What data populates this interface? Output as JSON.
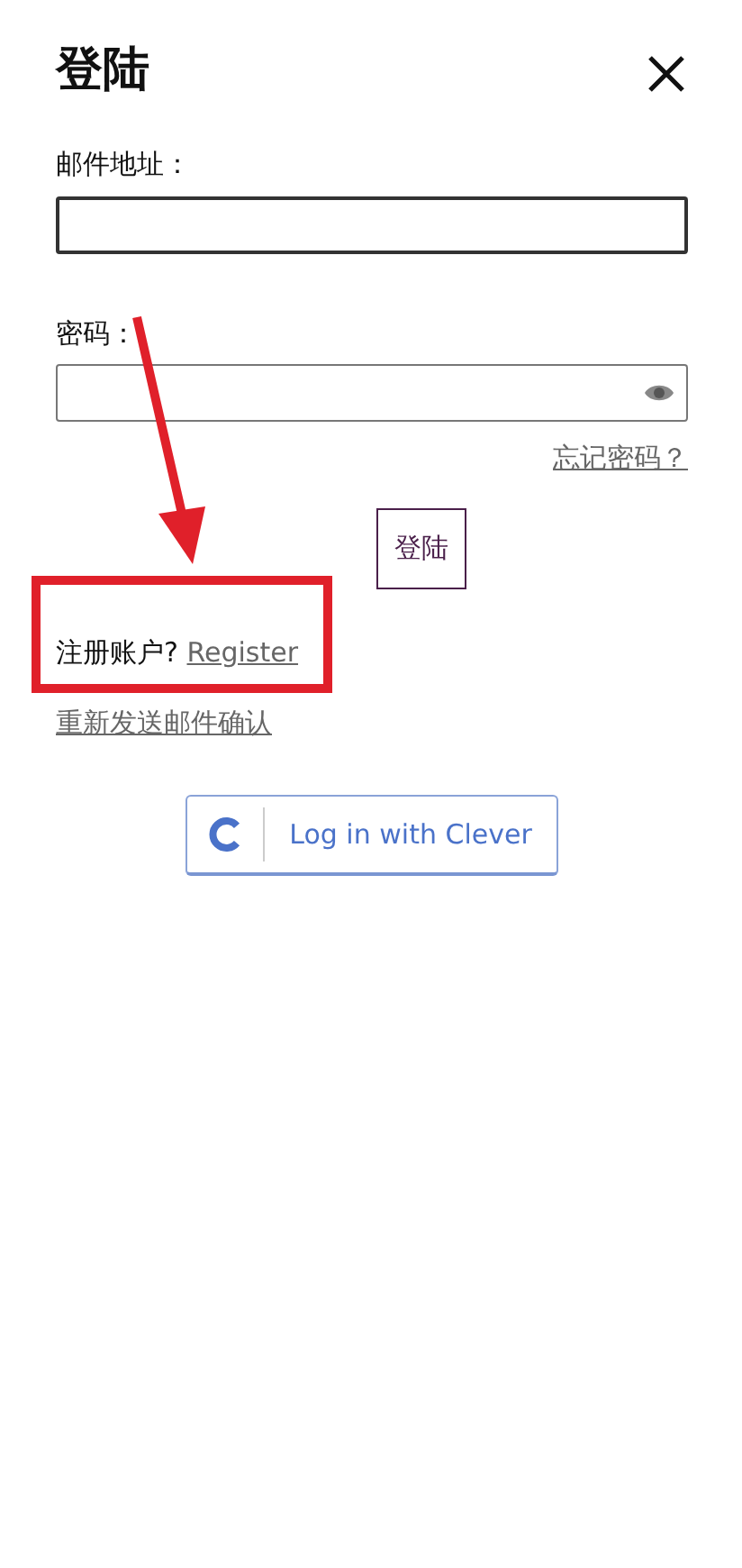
{
  "title": "登陆",
  "fields": [
    {
      "label": "邮件地址：",
      "kind": "text",
      "focused": true
    },
    {
      "label": "密码：",
      "kind": "password",
      "focused": false
    }
  ],
  "forgot_link": "忘记密码？",
  "submit_button": "登陆",
  "register": {
    "prompt": "注册账户?",
    "link": "Register"
  },
  "resend_link": "重新发送邮件确认",
  "clever_button": "Log in with Clever",
  "annotation": {
    "arrow": true,
    "highlight_frame": true
  }
}
